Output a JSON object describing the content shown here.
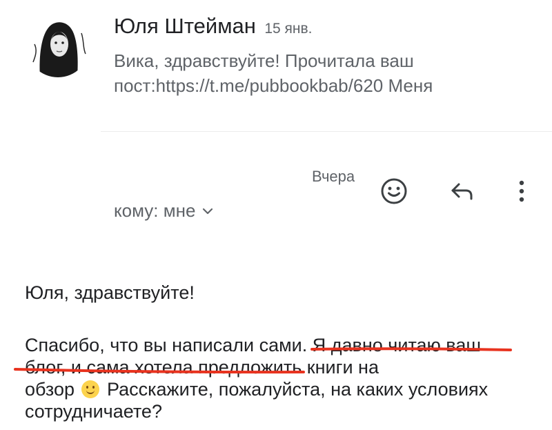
{
  "first_message": {
    "sender": "Юля Штейман",
    "date": "15 янв.",
    "snippet_line1": "Вика, здравствуйте! Прочитала ваш",
    "snippet_line2": "пост:https://t.me/pubbookbab/620 Меня"
  },
  "reply": {
    "date": "Вчера",
    "recipient": "кому: мне",
    "actions": [
      "emoji-reaction",
      "reply",
      "more"
    ],
    "body": {
      "greeting": "Юля, здравствуйте!",
      "line1_a": "Спасибо, что вы написали сами. ",
      "line1_b": "Я давно читаю ваш",
      "line2_a": "блог, и сама хотела предложить",
      "line2_b": " книги на",
      "line3_a": "обзор ",
      "line3_b": " Расскажите, пожалуйста, на каких условиях",
      "line4": "сотрудничаете?"
    }
  },
  "annotation": {
    "color": "#e8331f",
    "highlighted_text": "Я давно читаю ваш блог, и сама хотела предложить"
  }
}
